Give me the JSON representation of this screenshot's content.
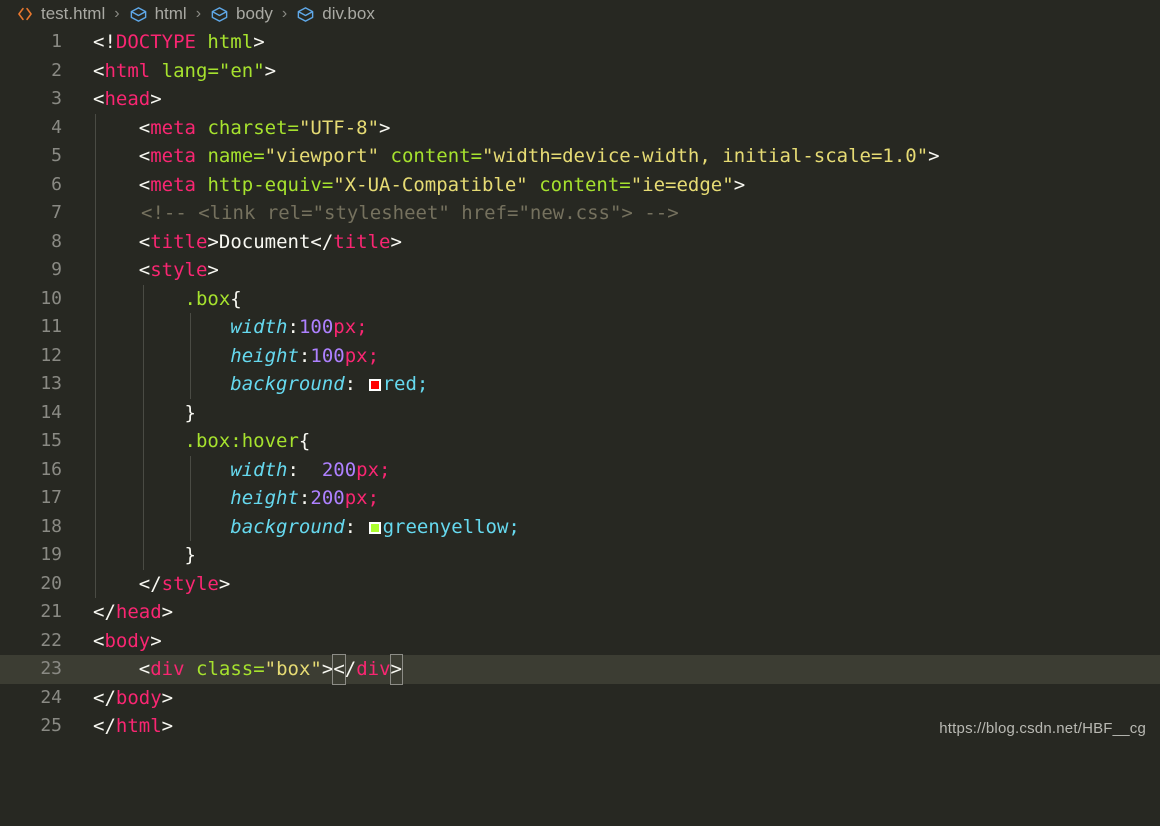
{
  "breadcrumb": {
    "items": [
      {
        "icon": "html-file-icon",
        "label": "test.html"
      },
      {
        "icon": "symbol-namespace-icon",
        "label": "html"
      },
      {
        "icon": "symbol-namespace-icon",
        "label": "body"
      },
      {
        "icon": "symbol-namespace-icon",
        "label": "div.box"
      }
    ],
    "separator": "›"
  },
  "editor": {
    "active_line": 23,
    "lines": [
      {
        "n": "1",
        "indent": 0
      },
      {
        "n": "2",
        "indent": 0
      },
      {
        "n": "3",
        "indent": 0
      },
      {
        "n": "4",
        "indent": 1
      },
      {
        "n": "5",
        "indent": 1
      },
      {
        "n": "6",
        "indent": 1
      },
      {
        "n": "7",
        "indent": 1
      },
      {
        "n": "8",
        "indent": 1
      },
      {
        "n": "9",
        "indent": 1
      },
      {
        "n": "10",
        "indent": 2
      },
      {
        "n": "11",
        "indent": 3
      },
      {
        "n": "12",
        "indent": 3
      },
      {
        "n": "13",
        "indent": 3
      },
      {
        "n": "14",
        "indent": 2
      },
      {
        "n": "15",
        "indent": 2
      },
      {
        "n": "16",
        "indent": 3
      },
      {
        "n": "17",
        "indent": 3
      },
      {
        "n": "18",
        "indent": 3
      },
      {
        "n": "19",
        "indent": 2
      },
      {
        "n": "20",
        "indent": 1
      },
      {
        "n": "21",
        "indent": 0
      },
      {
        "n": "22",
        "indent": 0
      },
      {
        "n": "23",
        "indent": 0
      },
      {
        "n": "24",
        "indent": 0
      },
      {
        "n": "25",
        "indent": 0
      }
    ],
    "source_text": {
      "l1": "<!DOCTYPE html>",
      "l2": "<html lang=\"en\">",
      "l3": "<head>",
      "l4": "    <meta charset=\"UTF-8\">",
      "l5": "    <meta name=\"viewport\" content=\"width=device-width, initial-scale=1.0\">",
      "l6": "    <meta http-equiv=\"X-UA-Compatible\" content=\"ie=edge\">",
      "l7": "    <!-- <link rel=\"stylesheet\" href=\"new.css\"> -->",
      "l8": "    <title>Document</title>",
      "l9": "    <style>",
      "l10": "        .box{",
      "l11": "            width:100px;",
      "l12": "            height:100px;",
      "l13": "            background: red;",
      "l14": "        }",
      "l15": "        .box:hover{",
      "l16": "            width:  200px;",
      "l17": "            height:200px;",
      "l18": "            background: greenyellow;",
      "l19": "        }",
      "l20": "    </style>",
      "l21": "</head>",
      "l22": "<body>",
      "l23": "    <div class=\"box\"></div>",
      "l24": "</body>",
      "l25": "</html>"
    },
    "tokens": {
      "doctype": "DOCTYPE",
      "tag_html": "html",
      "tag_head": "head",
      "tag_meta": "meta",
      "tag_title": "title",
      "tag_style": "style",
      "tag_body": "body",
      "tag_div": "div",
      "attr_lang": "lang",
      "attr_charset": "charset",
      "attr_name": "name",
      "attr_content": "content",
      "attr_httpequiv": "http-equiv",
      "attr_class": "class",
      "val_en": "\"en\"",
      "val_utf8": "\"UTF-8\"",
      "val_viewport": "\"viewport\"",
      "val_widthdevice": "\"width=device-width, initial-scale=1.0\"",
      "val_xua": "\"X-UA-Compatible\"",
      "val_ieedge": "\"ie=edge\"",
      "val_box": "\"box\"",
      "text_document": "Document",
      "comment_link": "<!-- <link rel=\"stylesheet\" href=\"new.css\"> -->",
      "sel_box": ".box",
      "sel_boxhover": ".box:hover",
      "prop_width": "width",
      "prop_height": "height",
      "prop_background": "background",
      "num_100": "100",
      "num_200": "200",
      "unit_px": "px",
      "val_red": "red",
      "val_greenyellow": "greenyellow",
      "brace_open": "{",
      "brace_close": "}",
      "semicolon": ";",
      "colon": ":"
    },
    "colors": {
      "background": "#272822",
      "active_line": "#3c3d33",
      "tag": "#f92672",
      "attribute": "#a6e22e",
      "string": "#e6db74",
      "comment": "#75715e",
      "property": "#66d9ef",
      "number": "#ae81ff",
      "foreground": "#f8f8f2",
      "line_number": "#8a8a84",
      "swatch_red": "#ff0000",
      "swatch_greenyellow": "#adff2f",
      "indent_guide": "#4a4b44"
    }
  },
  "watermark": {
    "text": "https://blog.csdn.net/HBF__cg"
  }
}
